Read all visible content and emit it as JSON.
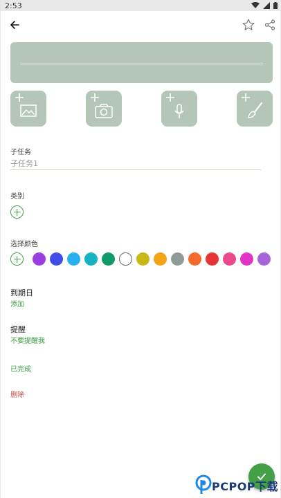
{
  "status_bar": {
    "time": "2:53"
  },
  "toolbar": {
    "back_icon": "arrow-left-icon",
    "star_icon": "star-outline-icon",
    "share_icon": "share-icon"
  },
  "attachments": [
    {
      "icon": "add-image-icon"
    },
    {
      "icon": "add-camera-icon"
    },
    {
      "icon": "add-mic-icon"
    },
    {
      "icon": "add-brush-icon"
    }
  ],
  "subtask": {
    "label": "子任务",
    "placeholder": "子任务1"
  },
  "category": {
    "label": "类别"
  },
  "color": {
    "label": "选择颜色",
    "swatches": [
      "#9b3ee0",
      "#3f4ee8",
      "#2aaff0",
      "#17b3c2",
      "#0f9a67",
      "#ffffff",
      "#c8b815",
      "#f4a416",
      "#8e9b96",
      "#f46a2a",
      "#e53535",
      "#ea4a8c",
      "#df36c9",
      "#a564d8"
    ]
  },
  "due_date": {
    "title": "到期日",
    "value": "添加"
  },
  "reminder": {
    "title": "提醒",
    "value": "不要提醒我"
  },
  "completed_label": "已完成",
  "delete_label": "删除",
  "watermark": {
    "brand": "PCPOP下载"
  },
  "colors": {
    "accent": "#43a047",
    "card": "#b4c6b8",
    "danger": "#c0504d"
  }
}
